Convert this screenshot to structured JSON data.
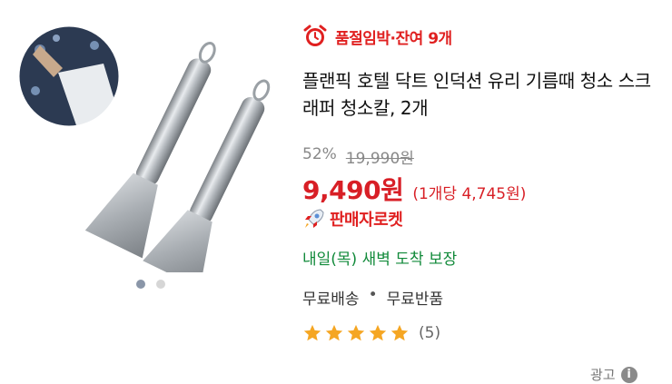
{
  "stock_alert": {
    "text": "품절임박·잔여 9개",
    "icon": "alarm-clock-icon",
    "color": "#e02020"
  },
  "product": {
    "title": "플랜픽 호텔 닥트 인덕션 유리 기름때 청소 스크래퍼 청소칼, 2개",
    "discount": "52%",
    "original_price": "19,990원",
    "price": "9,490원",
    "unit_price": "(1개당 4,745원)",
    "badge": {
      "text": "판매자로켓",
      "icon": "rocket-icon"
    },
    "delivery": "내일(목) 새벽 도착 보장",
    "shipping": {
      "free_shipping": "무료배송",
      "separator": "•",
      "free_return": "무료반품"
    },
    "rating": {
      "stars": 5,
      "max_stars": 5,
      "review_count": "(5)"
    }
  },
  "carousel": {
    "total": 2,
    "active_index": 0
  },
  "ad": {
    "label": "광고",
    "icon": "info-icon"
  },
  "colors": {
    "accent_red": "#d81f26",
    "delivery_green": "#118a3a",
    "star": "#f5a623"
  }
}
